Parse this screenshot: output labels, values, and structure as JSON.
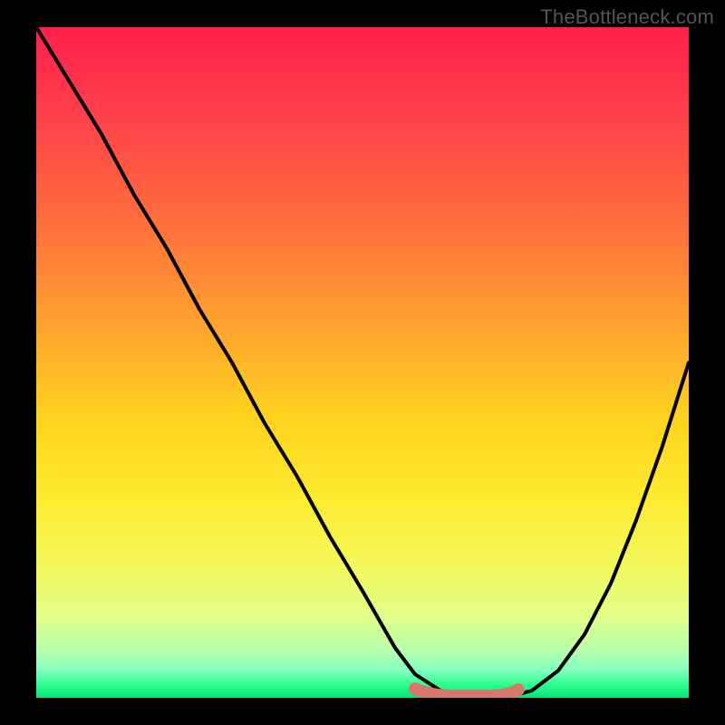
{
  "watermark": "TheBottleneck.com",
  "chart_data": {
    "type": "line",
    "title": "",
    "xlabel": "",
    "ylabel": "",
    "x": [
      0.0,
      0.05,
      0.1,
      0.15,
      0.2,
      0.25,
      0.3,
      0.35,
      0.4,
      0.45,
      0.5,
      0.55,
      0.58,
      0.62,
      0.66,
      0.7,
      0.72,
      0.76,
      0.8,
      0.84,
      0.88,
      0.92,
      0.96,
      1.0
    ],
    "values": [
      1.0,
      0.92,
      0.84,
      0.75,
      0.67,
      0.58,
      0.5,
      0.41,
      0.33,
      0.24,
      0.16,
      0.075,
      0.035,
      0.01,
      0.002,
      0.0,
      0.0,
      0.01,
      0.04,
      0.095,
      0.17,
      0.265,
      0.375,
      0.5
    ],
    "xlim": [
      0,
      1
    ],
    "ylim": [
      0,
      1
    ],
    "trough": {
      "start_x": 0.58,
      "end_x": 0.72,
      "y": 0.0
    },
    "color_scale": "red-yellow-green (top to bottom)"
  }
}
